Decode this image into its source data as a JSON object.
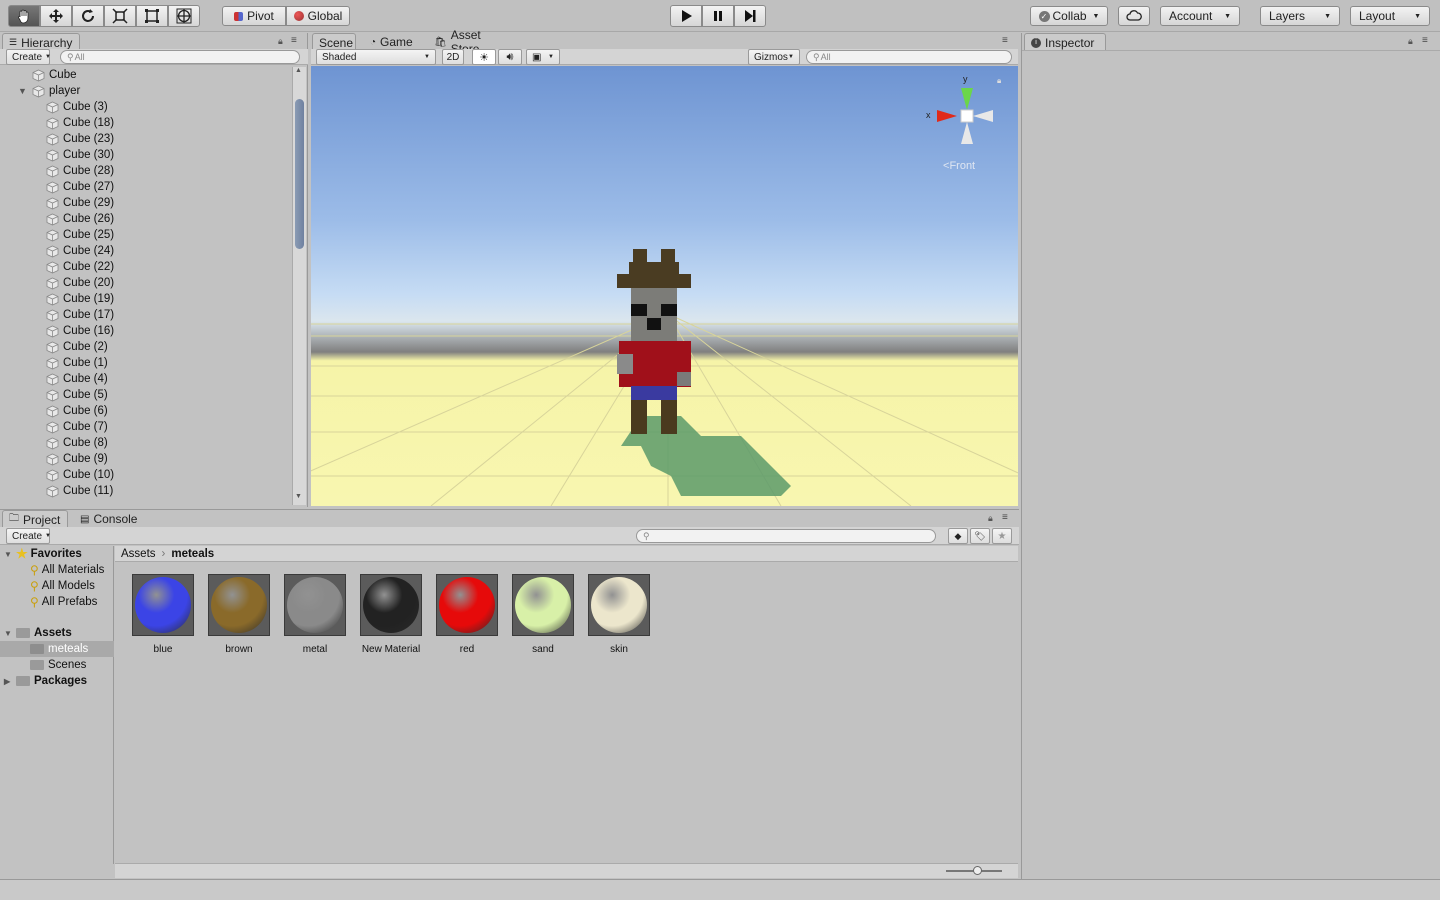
{
  "toolbar": {
    "tools": [
      "hand-tool",
      "move-tool",
      "rotate-tool",
      "scale-tool",
      "rect-tool",
      "transform-tool"
    ],
    "pivot_label": "Pivot",
    "global_label": "Global",
    "collab_label": "Collab",
    "account_label": "Account",
    "layers_label": "Layers",
    "layout_label": "Layout"
  },
  "hierarchy": {
    "tab_label": "Hierarchy",
    "create_label": "Create",
    "search_placeholder": "All",
    "root_item": "Cube",
    "parent_item": "player",
    "children": [
      "Cube (3)",
      "Cube (18)",
      "Cube (23)",
      "Cube (30)",
      "Cube (28)",
      "Cube (27)",
      "Cube (29)",
      "Cube (26)",
      "Cube (25)",
      "Cube (24)",
      "Cube (22)",
      "Cube (20)",
      "Cube (19)",
      "Cube (17)",
      "Cube (16)",
      "Cube (2)",
      "Cube (1)",
      "Cube (4)",
      "Cube (5)",
      "Cube (6)",
      "Cube (7)",
      "Cube (8)",
      "Cube (9)",
      "Cube (10)",
      "Cube (11)"
    ]
  },
  "scene": {
    "tabs": [
      "Scene",
      "Game",
      "Asset Store"
    ],
    "shading_mode": "Shaded",
    "mode_2d": "2D",
    "gizmos_label": "Gizmos",
    "search_placeholder": "All",
    "gizmo_view": "Front",
    "axis_y": "y",
    "axis_x": "x"
  },
  "inspector": {
    "tab_label": "Inspector"
  },
  "project": {
    "tabs": [
      "Project",
      "Console"
    ],
    "create_label": "Create",
    "favorites_label": "Favorites",
    "favorites": [
      "All Materials",
      "All Models",
      "All Prefabs"
    ],
    "assets_label": "Assets",
    "asset_folders": [
      "meteals",
      "Scenes"
    ],
    "packages_label": "Packages",
    "breadcrumb": [
      "Assets",
      "meteals"
    ],
    "materials": [
      {
        "name": "blue",
        "color": "#3b44e6"
      },
      {
        "name": "brown",
        "color": "#8a6a2a"
      },
      {
        "name": "metal",
        "color": "#8a8a8a"
      },
      {
        "name": "New Material",
        "color": "#222222"
      },
      {
        "name": "red",
        "color": "#e60a0a"
      },
      {
        "name": "sand",
        "color": "#d8f0a8"
      },
      {
        "name": "skin",
        "color": "#ece6cc"
      }
    ]
  }
}
